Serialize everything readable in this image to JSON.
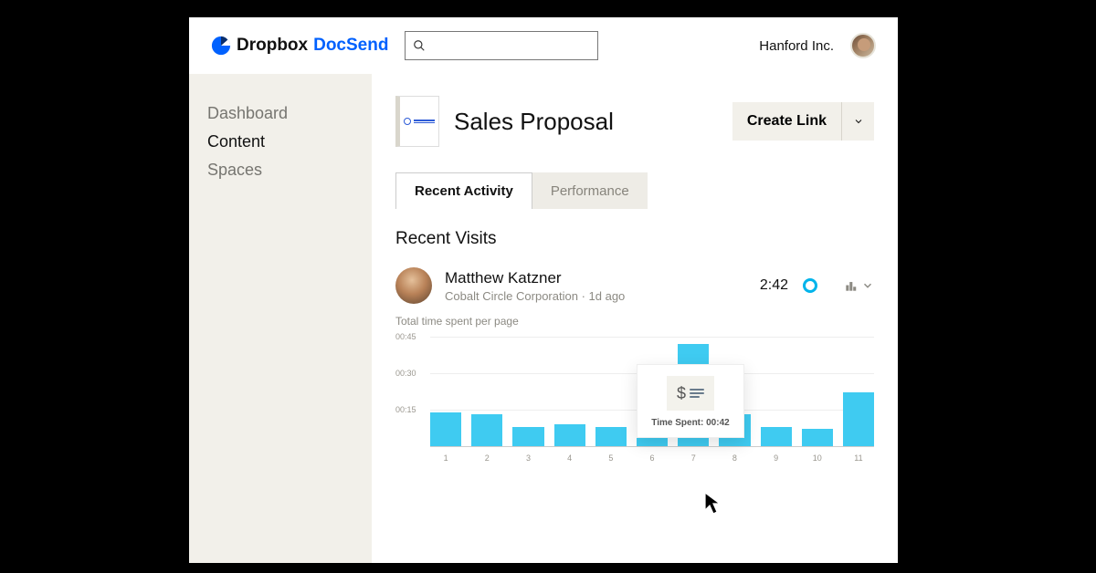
{
  "brand": {
    "main": "Dropbox",
    "sub": "DocSend"
  },
  "account": {
    "name": "Hanford Inc."
  },
  "sidebar": {
    "items": [
      {
        "label": "Dashboard",
        "active": false
      },
      {
        "label": "Content",
        "active": true
      },
      {
        "label": "Spaces",
        "active": false
      }
    ]
  },
  "document": {
    "title": "Sales Proposal",
    "create_link_label": "Create Link"
  },
  "tabs": [
    {
      "label": "Recent Activity",
      "active": true
    },
    {
      "label": "Performance",
      "active": false
    }
  ],
  "section": {
    "recent_visits_title": "Recent Visits"
  },
  "visit": {
    "name": "Matthew Katzner",
    "org": "Cobalt Circle Corporation",
    "age": "1d ago",
    "time": "2:42"
  },
  "tooltip": {
    "label": "Time Spent: 00:42"
  },
  "chart_caption": "Total time spent per page",
  "chart_data": {
    "type": "bar",
    "title": "Total time spent per page",
    "xlabel": "",
    "ylabel": "time",
    "y_ticks": [
      "00:45",
      "00:30",
      "00:15"
    ],
    "ylim": [
      0,
      45
    ],
    "categories": [
      "1",
      "2",
      "3",
      "4",
      "5",
      "6",
      "7",
      "8",
      "9",
      "10",
      "11"
    ],
    "values": [
      14,
      13,
      8,
      9,
      8,
      11,
      42,
      13,
      8,
      7,
      22
    ]
  }
}
